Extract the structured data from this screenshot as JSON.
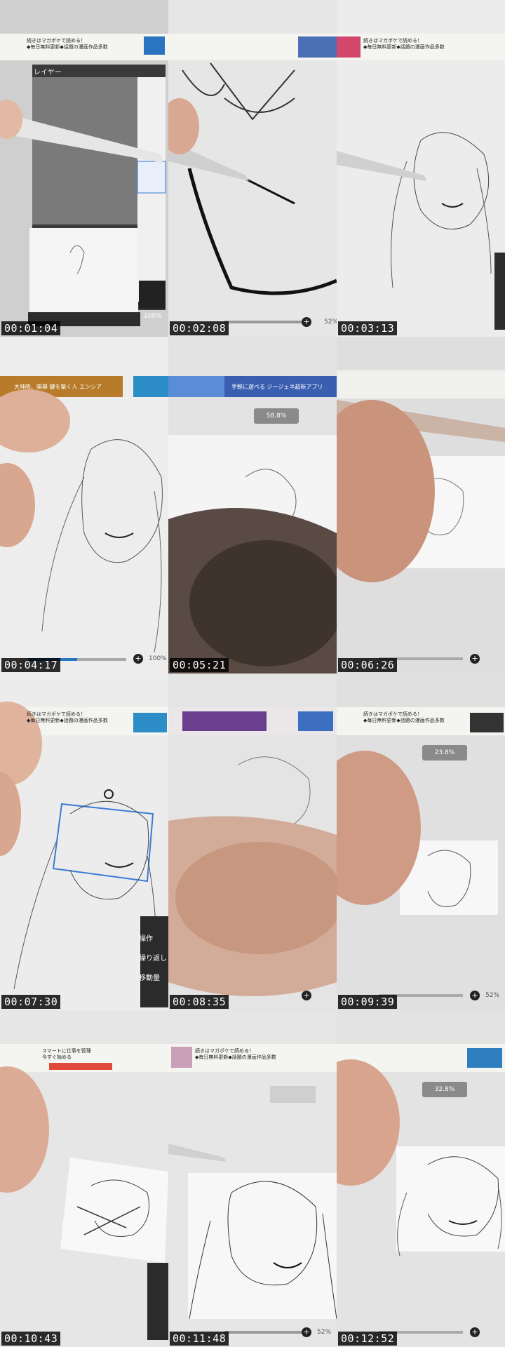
{
  "tiles": [
    {
      "time": "00:01:04",
      "ad": "続きはマガポケで読める！",
      "ad_sub": "◆毎日無料更新◆話題の漫画作品多数",
      "panel": "レイヤー",
      "zoom": "100%"
    },
    {
      "time": "00:02:08",
      "zoom": "52%"
    },
    {
      "time": "00:03:13",
      "ad": "続きはマガポケで読める！",
      "ad_sub": "◆毎日無料更新◆話題の漫画作品多数"
    },
    {
      "time": "00:04:17",
      "banner": "大神降、開幕 鍵を築く人 エンシア",
      "zoom": "100%"
    },
    {
      "time": "00:05:21",
      "banner": "手軽に遊べる ジージェネ超新アプリ",
      "pct": "58.8%"
    },
    {
      "time": "00:06:26"
    },
    {
      "time": "00:07:30",
      "ad": "続きはマガポケで読める！",
      "ad_sub": "◆毎日無料更新◆話題の漫画作品多数",
      "menu": [
        "操作",
        "繰り返し",
        "移動量"
      ]
    },
    {
      "time": "00:08:35"
    },
    {
      "time": "00:09:39",
      "ad": "続きはマガポケで読める！",
      "ad_sub": "◆毎日無料更新◆話題の漫画作品多数",
      "pct": "23.8%",
      "zoom": "52%"
    },
    {
      "time": "00:10:43",
      "ad": "スマートに仕事を管理",
      "ad_sub": "今すぐ始める"
    },
    {
      "time": "00:11:48",
      "ad": "続きはマガポケで読める！",
      "ad_sub": "◆毎日無料更新◆話題の漫画作品多数",
      "zoom": "52%"
    },
    {
      "time": "00:12:52",
      "pct": "32.8%"
    }
  ],
  "colors": {
    "skin": "#e2b9a3",
    "paper": "#f3f3f3",
    "line": "#333333",
    "ui_dark": "#2b2b2b",
    "select": "#3a7bd5"
  }
}
